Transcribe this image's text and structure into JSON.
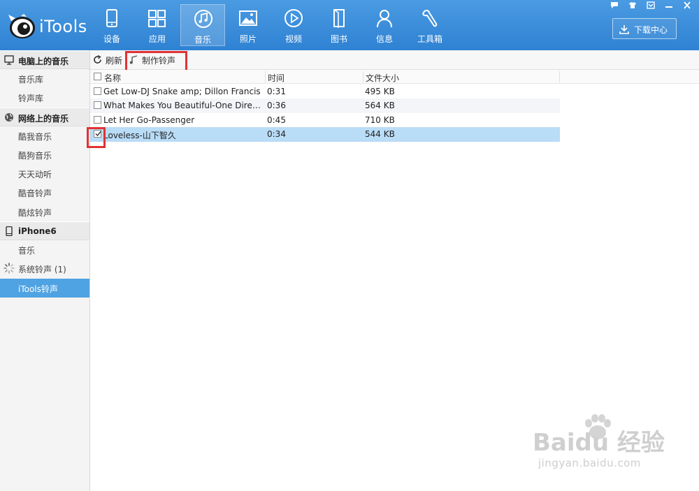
{
  "app": {
    "name": "iTools"
  },
  "nav": {
    "items": [
      {
        "label": "设备",
        "icon": "device-icon"
      },
      {
        "label": "应用",
        "icon": "apps-icon"
      },
      {
        "label": "音乐",
        "icon": "music-icon",
        "active": true
      },
      {
        "label": "照片",
        "icon": "photo-icon"
      },
      {
        "label": "视频",
        "icon": "video-icon"
      },
      {
        "label": "图书",
        "icon": "book-icon"
      },
      {
        "label": "信息",
        "icon": "contact-icon"
      },
      {
        "label": "工具箱",
        "icon": "toolbox-icon"
      }
    ]
  },
  "download": {
    "label": "下载中心"
  },
  "sidebar": {
    "sections": [
      {
        "title": "电脑上的音乐",
        "icon": "computer-icon",
        "items": [
          {
            "label": "音乐库"
          },
          {
            "label": "铃声库"
          }
        ]
      },
      {
        "title": "网络上的音乐",
        "icon": "globe-icon",
        "items": [
          {
            "label": "酷我音乐"
          },
          {
            "label": "酷狗音乐"
          },
          {
            "label": "天天动听"
          },
          {
            "label": "酷音铃声"
          },
          {
            "label": "酷炫铃声"
          }
        ]
      },
      {
        "title": "iPhone6",
        "icon": "phone-icon",
        "items": [
          {
            "label": "音乐"
          },
          {
            "label": "系统铃声 (1)"
          },
          {
            "label": "iTools铃声",
            "selected": true
          }
        ]
      }
    ]
  },
  "toolbar": {
    "refresh_label": "刷新",
    "make_ringtone_label": "制作铃声"
  },
  "table": {
    "columns": {
      "name": "名称",
      "time": "时间",
      "size": "文件大小"
    },
    "rows": [
      {
        "name": "Get Low-DJ Snake amp; Dillon Francis",
        "time": "0:31",
        "size": "495 KB",
        "checked": false
      },
      {
        "name": "What Makes You Beautiful-One Directi...",
        "time": "0:36",
        "size": "564 KB",
        "checked": false
      },
      {
        "name": "Let Her Go-Passenger",
        "time": "0:45",
        "size": "710 KB",
        "checked": false
      },
      {
        "name": "Loveless-山下智久",
        "time": "0:34",
        "size": "544 KB",
        "checked": true
      }
    ]
  },
  "watermark": {
    "main": "Baidu 经验",
    "sub": "jingyan.baidu.com"
  },
  "colors": {
    "header": "#3d8fdb",
    "selected_row": "#b9dcf7",
    "sidebar_selected": "#4fa3e3",
    "highlight": "#e03333"
  }
}
